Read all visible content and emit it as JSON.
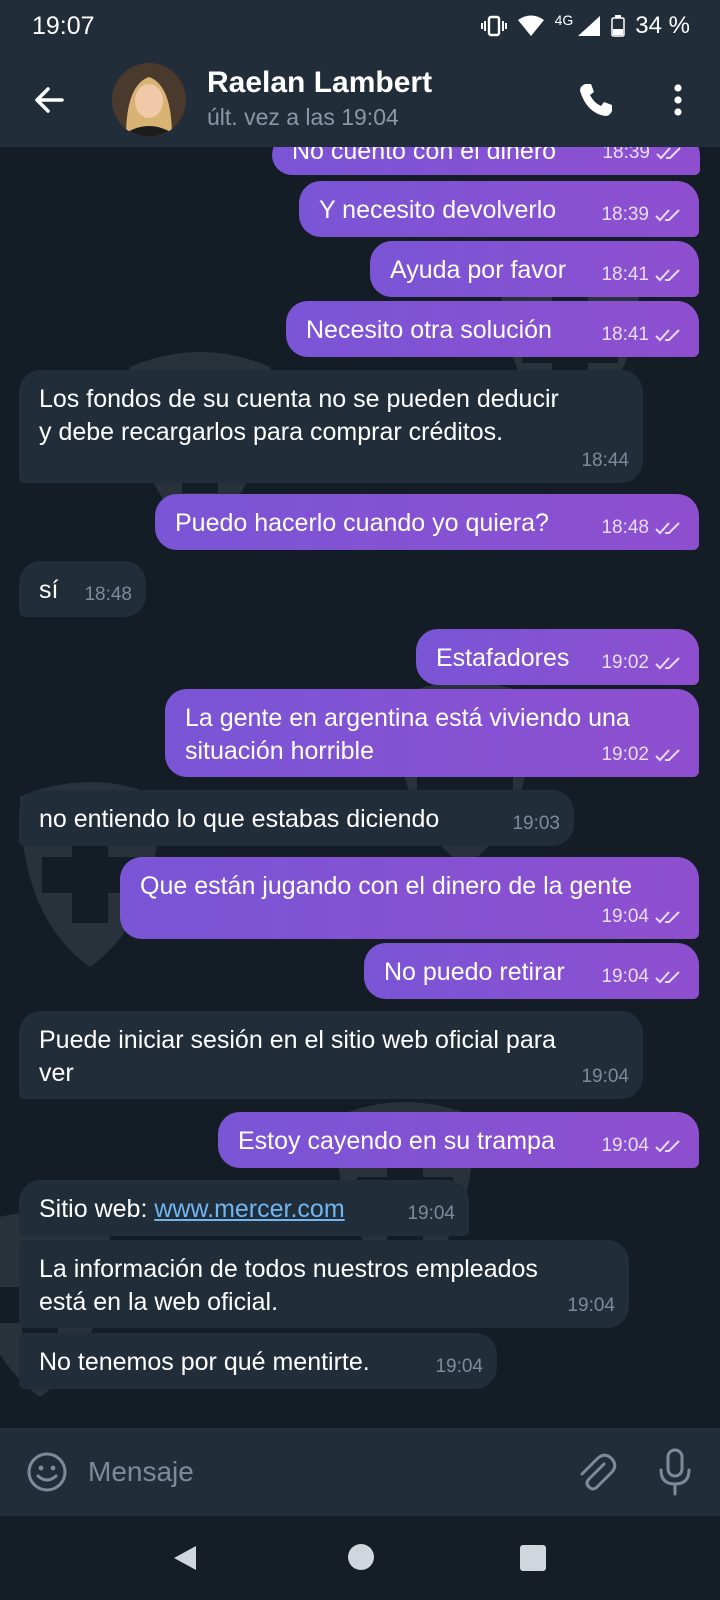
{
  "status_bar": {
    "time": "19:07",
    "network": "4G",
    "battery": "34 %"
  },
  "header": {
    "contact_name": "Raelan Lambert",
    "last_seen": "últ. vez a las 19:04"
  },
  "colors": {
    "outgoing_bubble": "#8a4fd0",
    "incoming_bubble": "#222d3a",
    "background": "#141c25",
    "link": "#6fb6f2"
  },
  "messages": [
    {
      "dir": "out",
      "text": "No cuento con el dinero",
      "time": "18:39"
    },
    {
      "dir": "out",
      "text": "Y necesito devolverlo",
      "time": "18:39"
    },
    {
      "dir": "out",
      "text": "Ayuda por favor",
      "time": "18:41"
    },
    {
      "dir": "out",
      "text": "Necesito otra solución",
      "time": "18:41"
    },
    {
      "dir": "in",
      "line1": "Los fondos de su cuenta no se pueden deducir",
      "line2": "y debe recargarlos para comprar créditos.",
      "time": "18:44"
    },
    {
      "dir": "out",
      "text": "Puedo hacerlo cuando yo quiera?",
      "time": "18:48"
    },
    {
      "dir": "in",
      "text": "sí",
      "time": "18:48"
    },
    {
      "dir": "out",
      "text": "Estafadores",
      "time": "19:02"
    },
    {
      "dir": "out",
      "line1": "La gente en argentina está viviendo una",
      "line2": "situación horrible",
      "time": "19:02"
    },
    {
      "dir": "in",
      "text": "no entiendo lo que estabas diciendo",
      "time": "19:03"
    },
    {
      "dir": "out",
      "text": "Que están jugando con el dinero de la gente",
      "time": "19:04"
    },
    {
      "dir": "out",
      "text": "No puedo retirar",
      "time": "19:04"
    },
    {
      "dir": "in",
      "line1": "Puede iniciar sesión en el sitio web oficial para",
      "line2": "ver",
      "time": "19:04"
    },
    {
      "dir": "out",
      "text": "Estoy cayendo en su trampa",
      "time": "19:04"
    },
    {
      "dir": "in",
      "prefix": "Sitio web: ",
      "link": "www.mercer.com",
      "time": "19:04"
    },
    {
      "dir": "in",
      "line1": "La información de todos nuestros empleados",
      "line2": "está en la web oficial.",
      "time": "19:04"
    },
    {
      "dir": "in",
      "text": "No tenemos por qué mentirte.",
      "time": "19:04"
    }
  ],
  "input": {
    "placeholder": "Mensaje"
  },
  "icons": {
    "back": "arrow-left-icon",
    "call": "phone-icon",
    "menu": "more-vertical-icon",
    "emoji": "smiley-icon",
    "attach": "paperclip-icon",
    "mic": "microphone-icon",
    "read_receipt": "double-check-icon"
  }
}
